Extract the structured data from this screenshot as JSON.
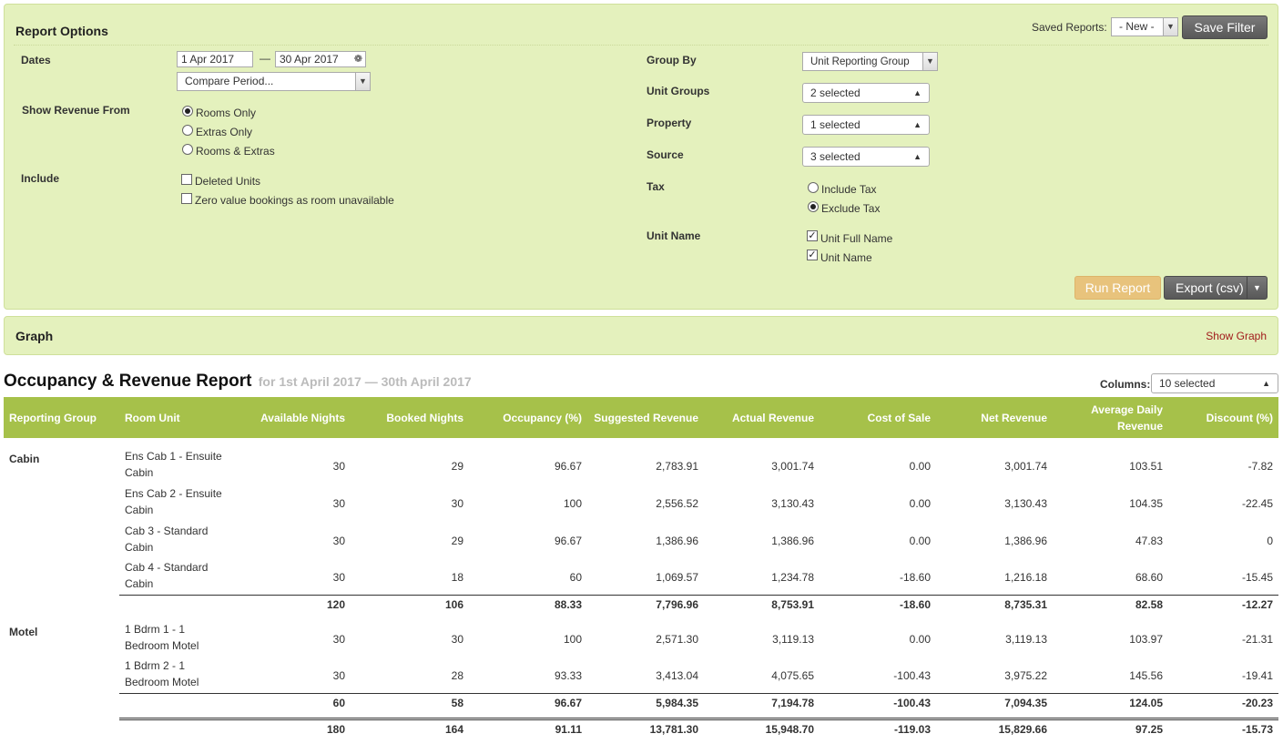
{
  "report_options": {
    "title": "Report Options",
    "saved_reports_label": "Saved Reports:",
    "saved_reports_value": "- New -",
    "save_filter_label": "Save Filter",
    "dates_label": "Dates",
    "date_from": "1 Apr 2017",
    "date_sep": "—",
    "date_to": "30 Apr 2017",
    "compare_period": "Compare Period...",
    "show_revenue_label": "Show Revenue From",
    "revenue_options": [
      "Rooms Only",
      "Extras Only",
      "Rooms & Extras"
    ],
    "revenue_selected": "Rooms Only",
    "include_label": "Include",
    "include_options": [
      "Deleted Units",
      "Zero value bookings as room unavailable"
    ],
    "group_by_label": "Group By",
    "group_by_value": "Unit Reporting Group",
    "unit_groups_label": "Unit Groups",
    "unit_groups_value": "2 selected",
    "property_label": "Property",
    "property_value": "1 selected",
    "source_label": "Source",
    "source_value": "3 selected",
    "tax_label": "Tax",
    "tax_options": [
      "Include Tax",
      "Exclude Tax"
    ],
    "tax_selected": "Exclude Tax",
    "unit_name_label": "Unit Name",
    "unit_name_options": [
      "Unit Full Name",
      "Unit Name"
    ],
    "run_report_label": "Run Report",
    "export_label": "Export (csv)"
  },
  "graph": {
    "title": "Graph",
    "show_graph_label": "Show Graph"
  },
  "report": {
    "title": "Occupancy & Revenue Report",
    "period": "for 1st April 2017 — 30th April 2017",
    "columns_label": "Columns:",
    "columns_value": "10 selected",
    "headers": [
      "Reporting Group",
      "Room Unit",
      "Available Nights",
      "Booked Nights",
      "Occupancy (%)",
      "Suggested Revenue",
      "Actual Revenue",
      "Cost of Sale",
      "Net Revenue",
      "Average Daily Revenue",
      "Discount (%)"
    ],
    "groups": [
      {
        "name": "Cabin",
        "rows": [
          {
            "unit": "Ens Cab 1 - Ensuite Cabin",
            "vals": [
              "30",
              "29",
              "96.67",
              "2,783.91",
              "3,001.74",
              "0.00",
              "3,001.74",
              "103.51",
              "-7.82"
            ]
          },
          {
            "unit": "Ens Cab 2 - Ensuite Cabin",
            "vals": [
              "30",
              "30",
              "100",
              "2,556.52",
              "3,130.43",
              "0.00",
              "3,130.43",
              "104.35",
              "-22.45"
            ]
          },
          {
            "unit": "Cab 3 - Standard Cabin",
            "vals": [
              "30",
              "29",
              "96.67",
              "1,386.96",
              "1,386.96",
              "0.00",
              "1,386.96",
              "47.83",
              "0"
            ]
          },
          {
            "unit": "Cab 4 - Standard Cabin",
            "vals": [
              "30",
              "18",
              "60",
              "1,069.57",
              "1,234.78",
              "-18.60",
              "1,216.18",
              "68.60",
              "-15.45"
            ]
          }
        ],
        "subtotal": [
          "120",
          "106",
          "88.33",
          "7,796.96",
          "8,753.91",
          "-18.60",
          "8,735.31",
          "82.58",
          "-12.27"
        ]
      },
      {
        "name": "Motel",
        "rows": [
          {
            "unit": "1 Bdrm 1 - 1 Bedroom Motel",
            "vals": [
              "30",
              "30",
              "100",
              "2,571.30",
              "3,119.13",
              "0.00",
              "3,119.13",
              "103.97",
              "-21.31"
            ]
          },
          {
            "unit": "1 Bdrm 2 - 1 Bedroom Motel",
            "vals": [
              "30",
              "28",
              "93.33",
              "3,413.04",
              "4,075.65",
              "-100.43",
              "3,975.22",
              "145.56",
              "-19.41"
            ]
          }
        ],
        "subtotal": [
          "60",
          "58",
          "96.67",
          "5,984.35",
          "7,194.78",
          "-100.43",
          "7,094.35",
          "124.05",
          "-20.23"
        ]
      }
    ],
    "total": [
      "180",
      "164",
      "91.11",
      "13,781.30",
      "15,948.70",
      "-119.03",
      "15,829.66",
      "97.25",
      "-15.73"
    ]
  },
  "colors": {
    "panel_bg": "#e4f1bd",
    "table_header": "#a6c14a",
    "link": "#a11b1b",
    "run_button": "#e8c37c",
    "dark_button": "#666666"
  }
}
